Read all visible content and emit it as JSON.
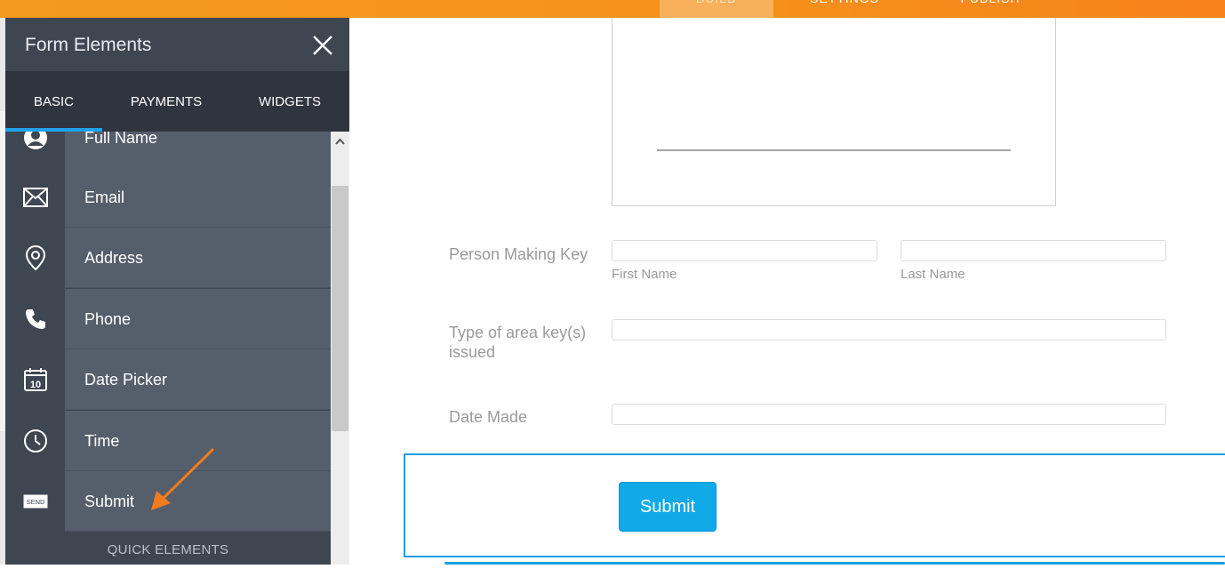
{
  "topnav": {
    "tabs": [
      {
        "label": "BUILD"
      },
      {
        "label": "SETTINGS"
      },
      {
        "label": "PUBLISH"
      }
    ]
  },
  "panel": {
    "title": "Form Elements",
    "tabs": [
      {
        "label": "BASIC"
      },
      {
        "label": "PAYMENTS"
      },
      {
        "label": "WIDGETS"
      }
    ],
    "items": [
      {
        "label": "Full Name",
        "icon": "user-icon"
      },
      {
        "label": "Email",
        "icon": "envelope-icon"
      },
      {
        "label": "Address",
        "icon": "location-pin-icon"
      },
      {
        "label": "Phone",
        "icon": "phone-icon"
      },
      {
        "label": "Date Picker",
        "icon": "calendar-icon",
        "icon_text": "10"
      },
      {
        "label": "Time",
        "icon": "clock-icon"
      },
      {
        "label": "Submit",
        "icon": "send-icon",
        "icon_text": "SEND"
      }
    ],
    "footer": "QUICK ELEMENTS"
  },
  "form": {
    "person_label": "Person Making Key",
    "first_name_sublabel": "First Name",
    "last_name_sublabel": "Last Name",
    "area_key_label_line1": "Type of area key(s)",
    "area_key_label_line2": "issued",
    "date_made_label": "Date Made",
    "submit_label": "Submit"
  },
  "colors": {
    "accent_orange": "#f6911a",
    "panel_dark": "#3e4652",
    "item_bg": "#555e6b",
    "active_tab_underline": "#1da1e8",
    "submit_blue": "#10aae8"
  }
}
